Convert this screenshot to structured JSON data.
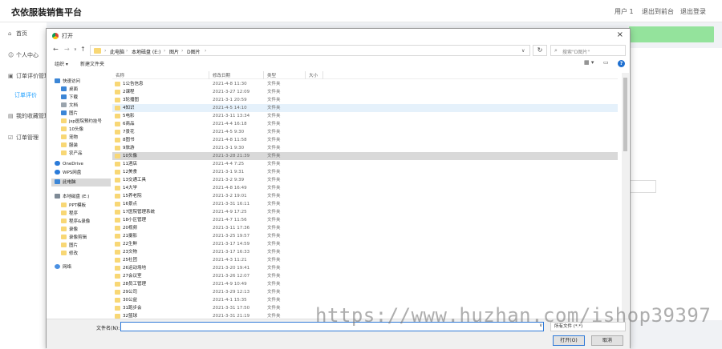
{
  "app": {
    "title": "衣依服装销售平台",
    "user": "用户 1",
    "back_to_admin": "退出到前台",
    "logout": "退出登录"
  },
  "sidebar": {
    "items": [
      {
        "label": "首页"
      },
      {
        "label": "个人中心"
      },
      {
        "label": "订单评价管理"
      },
      {
        "label": "订单评价"
      },
      {
        "label": "我的收藏管理"
      },
      {
        "label": "订单管理"
      }
    ]
  },
  "dialog": {
    "title": "打开",
    "close": "×",
    "breadcrumb": [
      "此电脑",
      "本地磁盘 (E:)",
      "图片",
      "D图片"
    ],
    "search_placeholder": "搜索\"D图片\"",
    "organize": "组织 ▾",
    "new_folder": "新建文件夹",
    "help": "?",
    "columns": [
      "名称",
      "修改日期",
      "类型",
      "大小"
    ],
    "tree": [
      {
        "label": "快速访问",
        "icon": "star",
        "pin": false
      },
      {
        "label": "桌面",
        "icon": "blue",
        "pin": true
      },
      {
        "label": "下载",
        "icon": "blue",
        "pin": true
      },
      {
        "label": "文档",
        "icon": "gray",
        "pin": true
      },
      {
        "label": "图片",
        "icon": "blue",
        "pin": true
      },
      {
        "label": "jsp医院预约挂号",
        "icon": "folder",
        "pin": true
      },
      {
        "label": "10头像",
        "icon": "folder",
        "pin": false
      },
      {
        "label": "宠物",
        "icon": "folder",
        "pin": false
      },
      {
        "label": "服装",
        "icon": "folder",
        "pin": false
      },
      {
        "label": "农产品",
        "icon": "folder",
        "pin": false
      },
      {
        "label": "OneDrive",
        "icon": "cloud",
        "pin": false
      },
      {
        "label": "WPS网盘",
        "icon": "cloud",
        "pin": false
      },
      {
        "label": "此电脑",
        "icon": "blue",
        "pin": false
      },
      {
        "label": "本地磁盘 (E:)",
        "icon": "drive",
        "pin": false
      },
      {
        "label": "PPT模板",
        "icon": "folder",
        "pin": false
      },
      {
        "label": "程序",
        "icon": "folder",
        "pin": false
      },
      {
        "label": "程序&录像",
        "icon": "folder",
        "pin": false
      },
      {
        "label": "录像",
        "icon": "folder",
        "pin": false
      },
      {
        "label": "录像剪辑",
        "icon": "folder",
        "pin": false
      },
      {
        "label": "图片",
        "icon": "folder",
        "pin": false
      },
      {
        "label": "修改",
        "icon": "folder",
        "pin": false
      },
      {
        "label": "网络",
        "icon": "net",
        "pin": false
      }
    ],
    "files": [
      {
        "name": "1公告信息",
        "date": "2021-4-8 11:30",
        "type": "文件夹"
      },
      {
        "name": "2课程",
        "date": "2021-3-27 12:09",
        "type": "文件夹"
      },
      {
        "name": "3轮播图",
        "date": "2021-3-1 20:59",
        "type": "文件夹"
      },
      {
        "name": "4知识",
        "date": "2021-4-5 14:10",
        "type": "文件夹"
      },
      {
        "name": "5电影",
        "date": "2021-3-11 13:34",
        "type": "文件夹"
      },
      {
        "name": "6商品",
        "date": "2021-4-4 16:18",
        "type": "文件夹"
      },
      {
        "name": "7景花",
        "date": "2021-4-5 9:30",
        "type": "文件夹"
      },
      {
        "name": "8图书",
        "date": "2021-4-8 11:58",
        "type": "文件夹"
      },
      {
        "name": "9旅游",
        "date": "2021-3-1 9:30",
        "type": "文件夹"
      },
      {
        "name": "10头像",
        "date": "2021-3-28 21:39",
        "type": "文件夹"
      },
      {
        "name": "11酒店",
        "date": "2021-4-4 7:25",
        "type": "文件夹"
      },
      {
        "name": "12美食",
        "date": "2021-3-1 9:31",
        "type": "文件夹"
      },
      {
        "name": "13交通工具",
        "date": "2021-3-2 9:39",
        "type": "文件夹"
      },
      {
        "name": "14大学",
        "date": "2021-4-8 16:49",
        "type": "文件夹"
      },
      {
        "name": "15养老院",
        "date": "2021-3-2 19:01",
        "type": "文件夹"
      },
      {
        "name": "16景点",
        "date": "2021-3-31 16:11",
        "type": "文件夹"
      },
      {
        "name": "17医院管理系统",
        "date": "2021-4-9 17:25",
        "type": "文件夹"
      },
      {
        "name": "18小区管理",
        "date": "2021-4-7 11:56",
        "type": "文件夹"
      },
      {
        "name": "20视频",
        "date": "2021-3-11 17:36",
        "type": "文件夹"
      },
      {
        "name": "21摄影",
        "date": "2021-3-25 19:57",
        "type": "文件夹"
      },
      {
        "name": "22生鲜",
        "date": "2021-3-17 14:59",
        "type": "文件夹"
      },
      {
        "name": "23文物",
        "date": "2021-3-17 16:33",
        "type": "文件夹"
      },
      {
        "name": "25社团",
        "date": "2021-4-3 11:21",
        "type": "文件夹"
      },
      {
        "name": "26运动场地",
        "date": "2021-3-20 19:41",
        "type": "文件夹"
      },
      {
        "name": "27会议室",
        "date": "2021-3-26 12:07",
        "type": "文件夹"
      },
      {
        "name": "28员工管理",
        "date": "2021-4-9 10:49",
        "type": "文件夹"
      },
      {
        "name": "29公司",
        "date": "2021-3-29 12:13",
        "type": "文件夹"
      },
      {
        "name": "30公益",
        "date": "2021-4-1 15:35",
        "type": "文件夹"
      },
      {
        "name": "31跑步会",
        "date": "2021-3-31 17:50",
        "type": "文件夹"
      },
      {
        "name": "32篮球",
        "date": "2021-3-31 21:19",
        "type": "文件夹"
      }
    ],
    "hover_index": 3,
    "selected_index": 9,
    "filename_label": "文件名(N):",
    "filename_value": "",
    "filetype": "所有文件 (*.*)",
    "open_button": "打开(O)",
    "cancel_button": "取消"
  },
  "watermark": "https://www.huzhan.com/ishop39397",
  "colors": {
    "accent": "#1e9fff",
    "green_bar": "#94e39c",
    "folder": "#f8d775"
  }
}
